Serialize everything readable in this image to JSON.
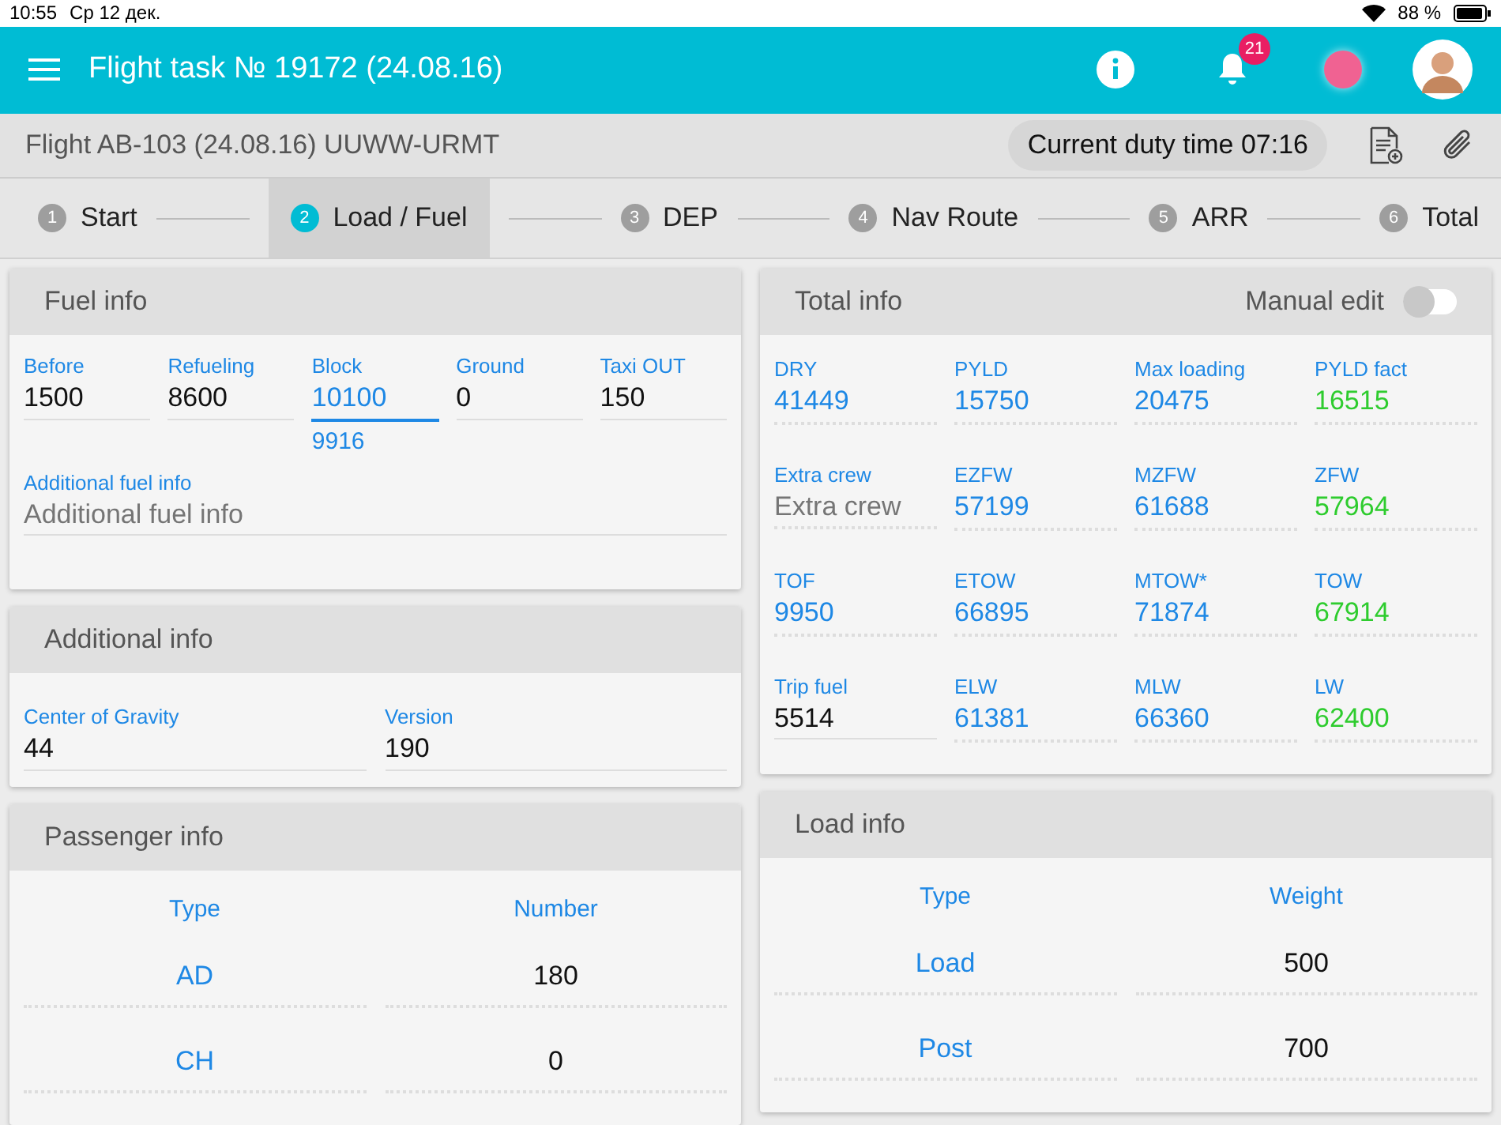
{
  "status_bar": {
    "time": "10:55",
    "date": "Ср 12 дек.",
    "battery": "88 %"
  },
  "header": {
    "title": "Flight task № 19172 (24.08.16)",
    "notifications": "21"
  },
  "subheader": {
    "flight": "Flight AB-103 (24.08.16) UUWW-URMT",
    "duty_time": "Current duty time 07:16"
  },
  "steps": [
    {
      "number": "1",
      "label": "Start",
      "selected": false
    },
    {
      "number": "2",
      "label": "Load / Fuel",
      "selected": true
    },
    {
      "number": "3",
      "label": "DEP",
      "selected": false
    },
    {
      "number": "4",
      "label": "Nav Route",
      "selected": false
    },
    {
      "number": "5",
      "label": "ARR",
      "selected": false
    },
    {
      "number": "6",
      "label": "Total",
      "selected": false
    }
  ],
  "fuel_info": {
    "title": "Fuel info",
    "fields": [
      {
        "label": "Before",
        "value": "1500",
        "focused": false
      },
      {
        "label": "Refueling",
        "value": "8600",
        "focused": false
      },
      {
        "label": "Block",
        "value": "10100",
        "focused": true,
        "hint": "9916"
      },
      {
        "label": "Ground",
        "value": "0",
        "focused": false
      },
      {
        "label": "Taxi OUT",
        "value": "150",
        "focused": false
      }
    ],
    "additional": {
      "label": "Additional fuel info",
      "placeholder": "Additional fuel info"
    }
  },
  "additional_info": {
    "title": "Additional info",
    "fields": [
      {
        "label": "Center of Gravity",
        "value": "44"
      },
      {
        "label": "Version",
        "value": "190"
      }
    ]
  },
  "total_info": {
    "title": "Total info",
    "manual_edit": {
      "label": "Manual edit",
      "on": false
    },
    "fields": [
      {
        "label": "DRY",
        "value": "41449",
        "kind": "computed"
      },
      {
        "label": "PYLD",
        "value": "15750",
        "kind": "computed"
      },
      {
        "label": "Max loading",
        "value": "20475",
        "kind": "computed"
      },
      {
        "label": "PYLD fact",
        "value": "16515",
        "kind": "fact"
      },
      {
        "label": "Extra crew",
        "placeholder": "Extra crew",
        "kind": "input"
      },
      {
        "label": "EZFW",
        "value": "57199",
        "kind": "computed"
      },
      {
        "label": "MZFW",
        "value": "61688",
        "kind": "computed"
      },
      {
        "label": "ZFW",
        "value": "57964",
        "kind": "fact"
      },
      {
        "label": "TOF",
        "value": "9950",
        "kind": "computed"
      },
      {
        "label": "ETOW",
        "value": "66895",
        "kind": "computed"
      },
      {
        "label": "MTOW*",
        "value": "71874",
        "kind": "computed"
      },
      {
        "label": "TOW",
        "value": "67914",
        "kind": "fact"
      },
      {
        "label": "Trip fuel",
        "value": "5514",
        "kind": "input"
      },
      {
        "label": "ELW",
        "value": "61381",
        "kind": "computed"
      },
      {
        "label": "MLW",
        "value": "66360",
        "kind": "computed"
      },
      {
        "label": "LW",
        "value": "62400",
        "kind": "fact"
      }
    ]
  },
  "passenger_info": {
    "title": "Passenger info",
    "columns": [
      "Type",
      "Number"
    ],
    "rows": [
      {
        "type": "AD",
        "number": "180"
      },
      {
        "type": "CH",
        "number": "0"
      }
    ]
  },
  "load_info": {
    "title": "Load info",
    "columns": [
      "Type",
      "Weight"
    ],
    "rows": [
      {
        "type": "Load",
        "weight": "500"
      },
      {
        "type": "Post",
        "weight": "700"
      }
    ]
  }
}
